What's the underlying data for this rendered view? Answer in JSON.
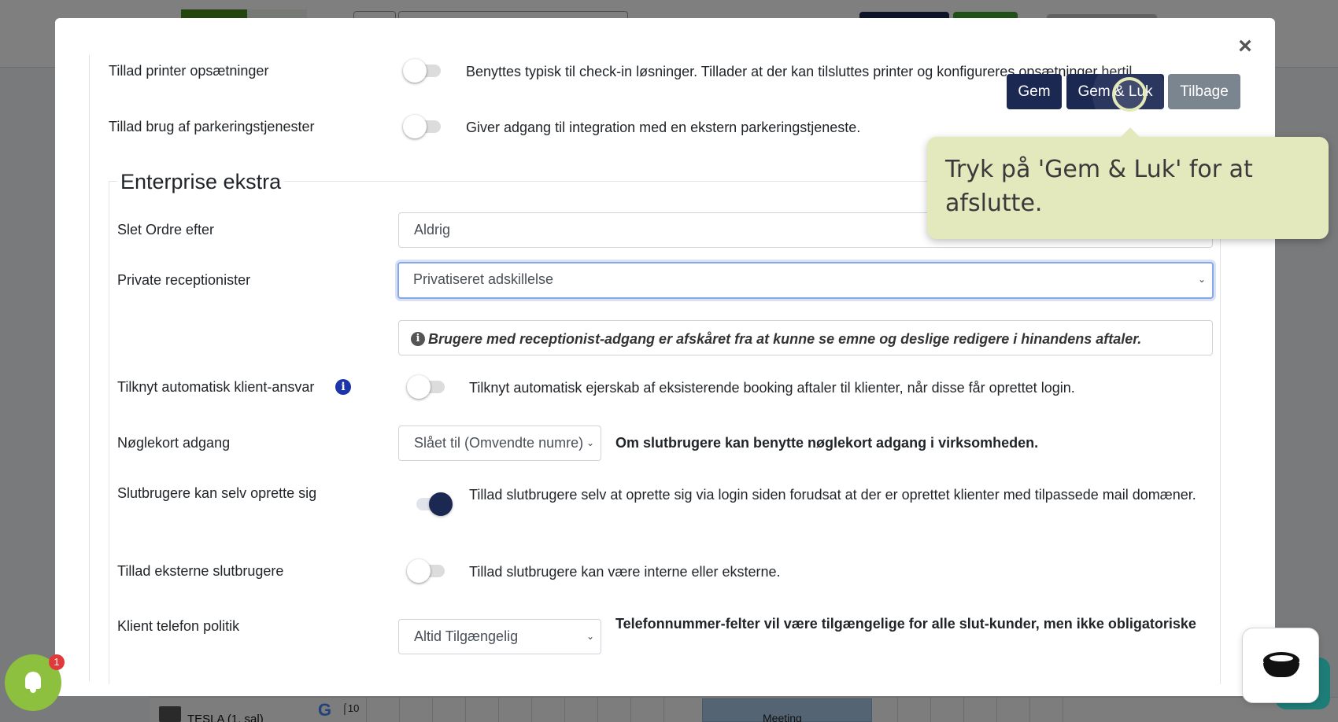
{
  "background": {
    "room_label": "TESLA (1. sal)",
    "google_glyph": "G",
    "clock_text": "⌠10",
    "meeting_label": "Meeting"
  },
  "modal": {
    "close_glyph": "×",
    "actions": {
      "save_label": "Gem",
      "save_close_label": "Gem & Luk",
      "back_label": "Tilbage"
    },
    "rows_top": [
      {
        "label": "Tillad printer opsætninger",
        "description": "Benyttes typisk til check-in løsninger. Tillader at der kan tilsluttes printer og konfigureres opsætninger hertil.",
        "enabled": false
      },
      {
        "label": "Tillad brug af parkeringstjenester",
        "description": "Giver adgang til integration med en ekstern parkeringstjeneste.",
        "enabled": false
      }
    ],
    "enterprise": {
      "legend": "Enterprise ekstra",
      "delete_orders": {
        "label": "Slet Ordre efter",
        "value": "Aldrig"
      },
      "private_receptionists": {
        "label": "Private receptionister",
        "value": "Privatiseret adskillelse",
        "info": "Brugere med receptionist-adgang er afskåret fra at kunne se emne og deslige redigere i hinandens aftaler."
      },
      "auto_client": {
        "label": "Tilknyt automatisk klient-ansvar",
        "description": "Tilknyt automatisk ejerskab af eksisterende booking aftaler til klienter, når disse får oprettet login.",
        "enabled": false
      },
      "keycard": {
        "label": "Nøglekort adgang",
        "value": "Slået til (Omvendte numre)",
        "description": "Om slutbrugere kan benytte nøglekort adgang i virksomheden."
      },
      "self_signup": {
        "label": "Slutbrugere kan selv oprette sig",
        "description": "Tillad slutbrugere selv at oprette sig via login siden forudsat at der er oprettet klienter med tilpassede mail domæner.",
        "enabled": true
      },
      "external_users": {
        "label": "Tillad eksterne slutbrugere",
        "description": "Tillad slutbrugere kan være interne eller eksterne.",
        "enabled": false
      },
      "phone_policy": {
        "label": "Klient telefon politik",
        "value": "Altid Tilgængelig",
        "description": "Telefonnummer-felter vil være tilgængelige for alle slut-kunder, men ikke obligatoriske"
      }
    }
  },
  "tooltip": {
    "text": "Tryk på 'Gem & Luk' for at afslutte."
  },
  "notifications": {
    "count": "1"
  },
  "colors": {
    "navy": "#1b2852",
    "grey": "#7b8590",
    "tooltip": "#e3e8bd",
    "bell": "#8ec03f"
  }
}
